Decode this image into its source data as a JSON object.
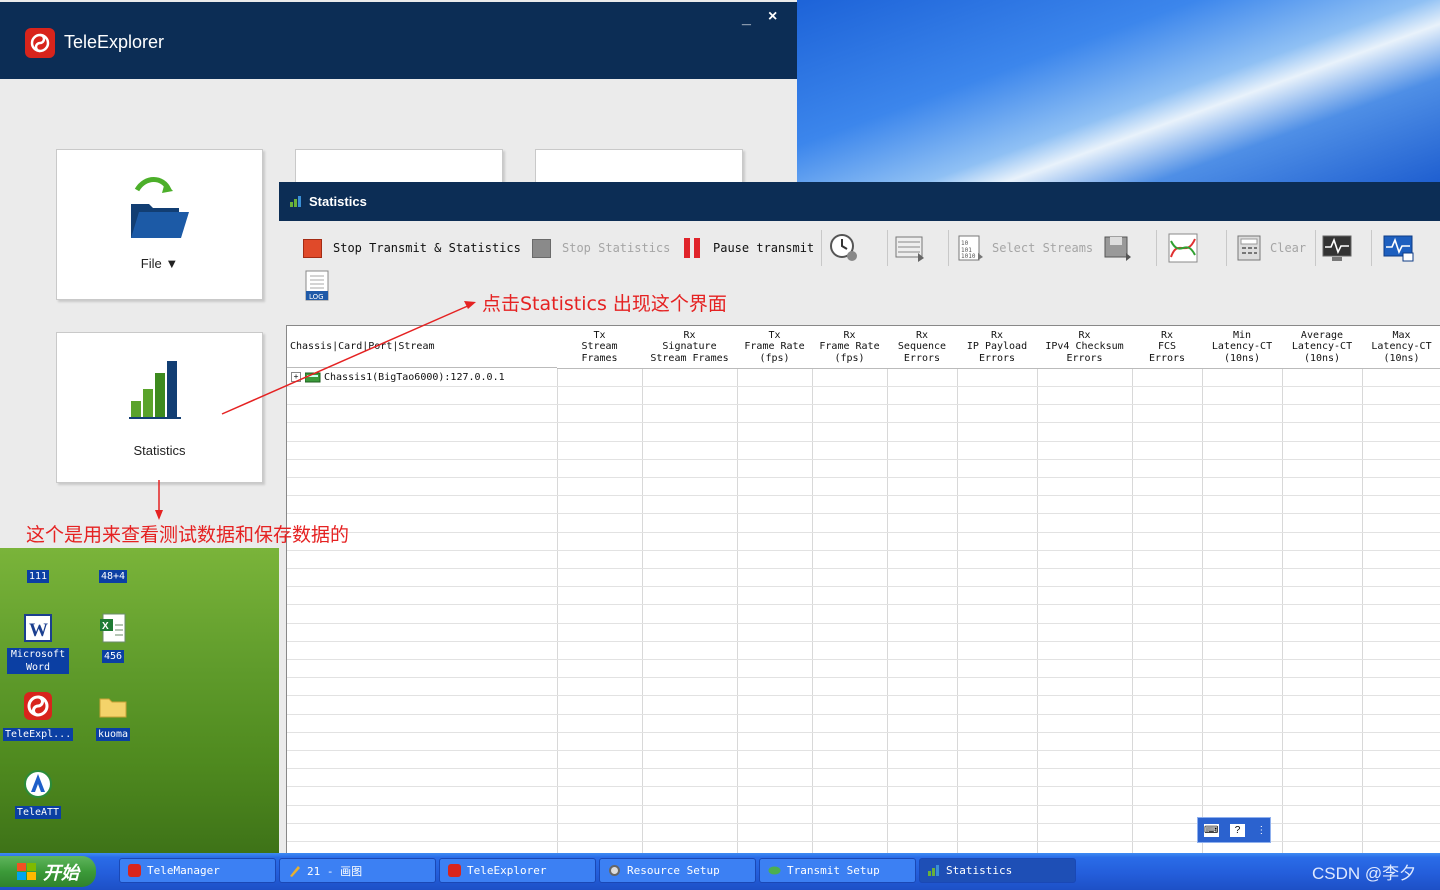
{
  "teleexplorer": {
    "title": "TeleExplorer",
    "minimize": "_",
    "close": "×",
    "tiles": {
      "file": "File ▼",
      "statistics": "Statistics"
    }
  },
  "statistics_window": {
    "title": "Statistics",
    "toolbar": {
      "stop_transmit": "Stop Transmit & Statistics",
      "stop_statistics": "Stop Statistics",
      "pause_transmit": "Pause transmit",
      "select_streams": "Select Streams",
      "clear": "Clear",
      "log": "LOG"
    },
    "columns": [
      "Chassis|Card|Port|Stream",
      "Tx\nStream\nFrames",
      "Rx\nSignature\nStream Frames",
      "Tx\nFrame Rate\n(fps)",
      "Rx\nFrame Rate\n(fps)",
      "Rx\nSequence\nErrors",
      "Rx\nIP Payload\nErrors",
      "Rx\nIPv4 Checksum\nErrors",
      "Rx\nFCS\nErrors",
      "Min\nLatency-CT\n(10ns)",
      "Average\nLatency-CT\n(10ns)",
      "Max\nLatency-CT\n(10ns)"
    ],
    "tree_row": "Chassis1(BigTao6000):127.0.0.1"
  },
  "annotations": {
    "click_note": "点击Statistics 出现这个界面",
    "purpose_note": "这个是用来查看测试数据和保存数据的"
  },
  "desktop_icons": [
    {
      "label": "111"
    },
    {
      "label": "48+4"
    },
    {
      "label": "Microsoft Word"
    },
    {
      "label": "456"
    },
    {
      "label": "TeleExpl..."
    },
    {
      "label": "kuoma"
    },
    {
      "label": "TeleATT"
    }
  ],
  "taskbar": {
    "start": "开始",
    "items": [
      "TeleManager",
      "21 - 画图",
      "TeleExplorer",
      "Resource Setup",
      "Transmit Setup",
      "Statistics"
    ],
    "watermark": "CSDN @李夕"
  },
  "ime": {
    "keys": [
      "⌨",
      "?",
      "⋮"
    ]
  }
}
